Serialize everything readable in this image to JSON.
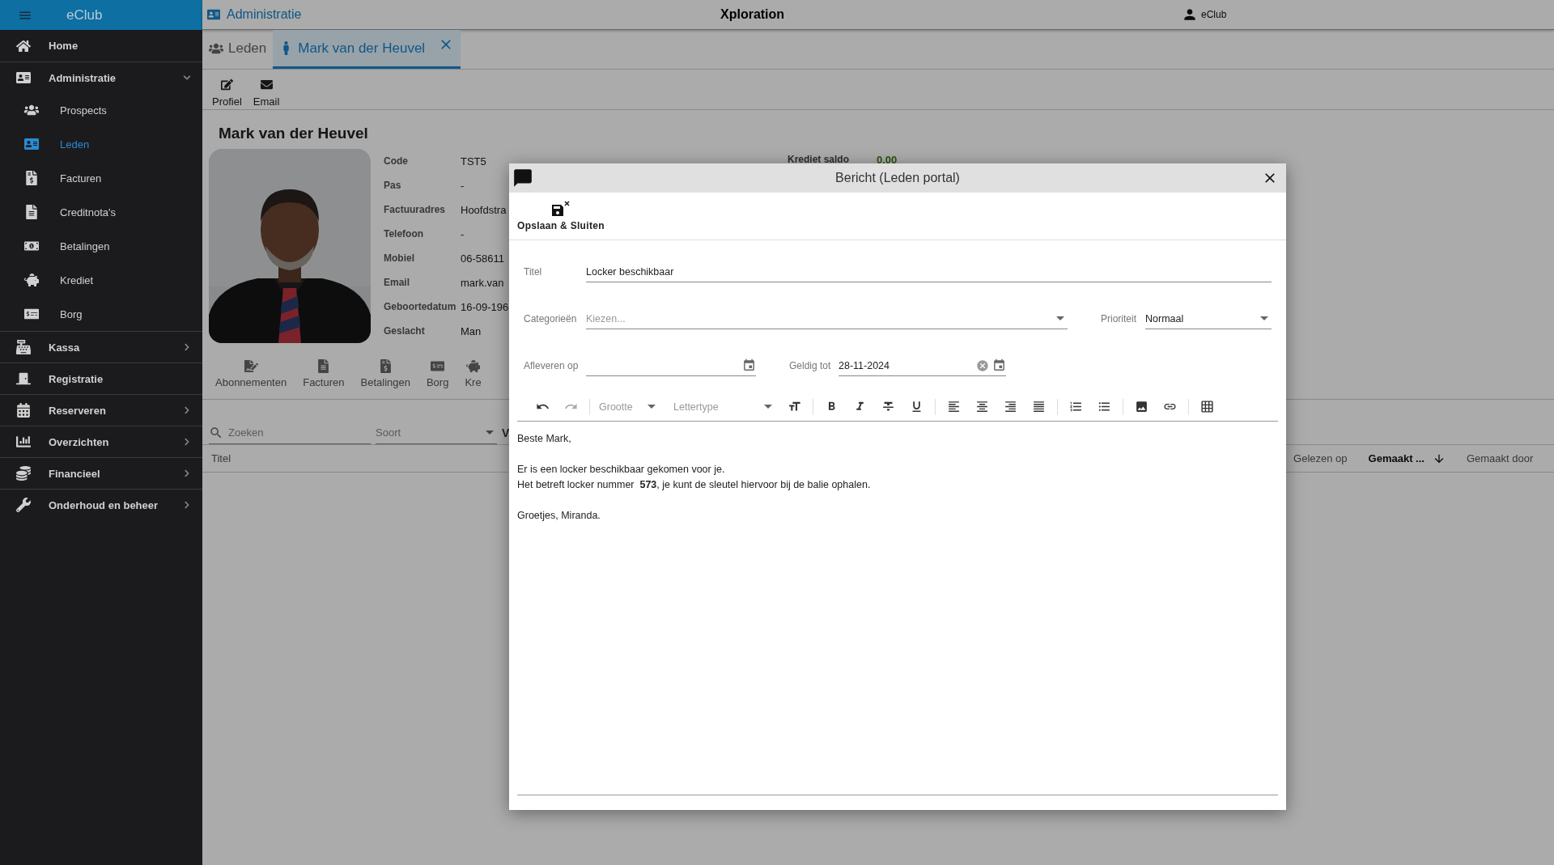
{
  "sidebar": {
    "title": "eClub",
    "items": [
      {
        "label": "Home",
        "kind": "link",
        "selected": false
      },
      {
        "label": "Administratie",
        "kind": "group",
        "expanded": true,
        "selected": false,
        "children": [
          {
            "label": "Prospects",
            "selected": false
          },
          {
            "label": "Leden",
            "selected": true
          },
          {
            "label": "Facturen",
            "selected": false
          },
          {
            "label": "Creditnota's",
            "selected": false
          },
          {
            "label": "Betalingen",
            "selected": false
          },
          {
            "label": "Krediet",
            "selected": false
          },
          {
            "label": "Borg",
            "selected": false
          }
        ]
      },
      {
        "label": "Kassa",
        "kind": "group",
        "expanded": false,
        "selected": false
      },
      {
        "label": "Registratie",
        "kind": "link",
        "selected": false
      },
      {
        "label": "Reserveren",
        "kind": "group",
        "expanded": false,
        "selected": false
      },
      {
        "label": "Overzichten",
        "kind": "group",
        "expanded": false,
        "selected": false
      },
      {
        "label": "Financieel",
        "kind": "group",
        "expanded": false,
        "selected": false
      },
      {
        "label": "Onderhoud en beheer",
        "kind": "group",
        "expanded": false,
        "selected": false
      }
    ]
  },
  "top_bar": {
    "section": "Administratie",
    "app_name": "Xploration",
    "user": "eClub"
  },
  "tabs": [
    {
      "label": "Leden",
      "selected": false,
      "closable": false
    },
    {
      "label": "Mark van der Heuvel",
      "selected": true,
      "closable": true
    }
  ],
  "actions": [
    "Profiel",
    "Email"
  ],
  "member": {
    "name": "Mark van der Heuvel",
    "fields": [
      {
        "label": "Code",
        "value": "TST5"
      },
      {
        "label": "Pas",
        "value": "-"
      },
      {
        "label": "Factuuradres",
        "value": "Hoofdstra"
      },
      {
        "label": "Telefoon",
        "value": "-"
      },
      {
        "label": "Mobiel",
        "value": "06-58611"
      },
      {
        "label": "Email",
        "value": "mark.van"
      },
      {
        "label": "Geboortedatum",
        "value": "16-09-196"
      },
      {
        "label": "Geslacht",
        "value": "Man"
      }
    ],
    "credit": {
      "label": "Krediet saldo",
      "value": "0.00"
    }
  },
  "sub_tabs": [
    "Abonnementen",
    "Facturen",
    "Betalingen",
    "Borg",
    "Kre"
  ],
  "filters": {
    "search_placeholder": "Zoeken",
    "type_placeholder": "Soort",
    "column_3": "V"
  },
  "table": {
    "columns": [
      {
        "label": "Titel",
        "sorted": false
      },
      {
        "label": "Gelezen op",
        "sorted": false
      },
      {
        "label": "Gemaakt ...",
        "sorted": true
      },
      {
        "label": "Gemaakt door",
        "sorted": false
      }
    ]
  },
  "dialog": {
    "title": "Bericht (Leden portal)",
    "save_label": "Opslaan & Sluiten",
    "title_field": {
      "label": "Titel",
      "value": "Locker beschikbaar"
    },
    "categories": {
      "label": "Categorieën",
      "placeholder": "Kiezen..."
    },
    "priority": {
      "label": "Prioriteit",
      "value": "Normaal"
    },
    "deliver_on": {
      "label": "Afleveren op"
    },
    "valid_until": {
      "label": "Geldig tot",
      "value": "28-11-2024"
    },
    "editor_toolbar": {
      "undo_disabled": false,
      "redo_disabled": true,
      "size_placeholder": "Grootte",
      "font_placeholder": "Lettertype"
    },
    "body": [
      {
        "lines": [
          "Beste Mark,"
        ]
      },
      {
        "lines": [
          "Er is een locker beschikbaar gekomen voor je.",
          "Het betreft locker nummer  **573**, je kunt de sleutel hiervoor bij de balie ophalen."
        ]
      },
      {
        "lines": [
          "Groetjes, Miranda."
        ]
      }
    ]
  }
}
